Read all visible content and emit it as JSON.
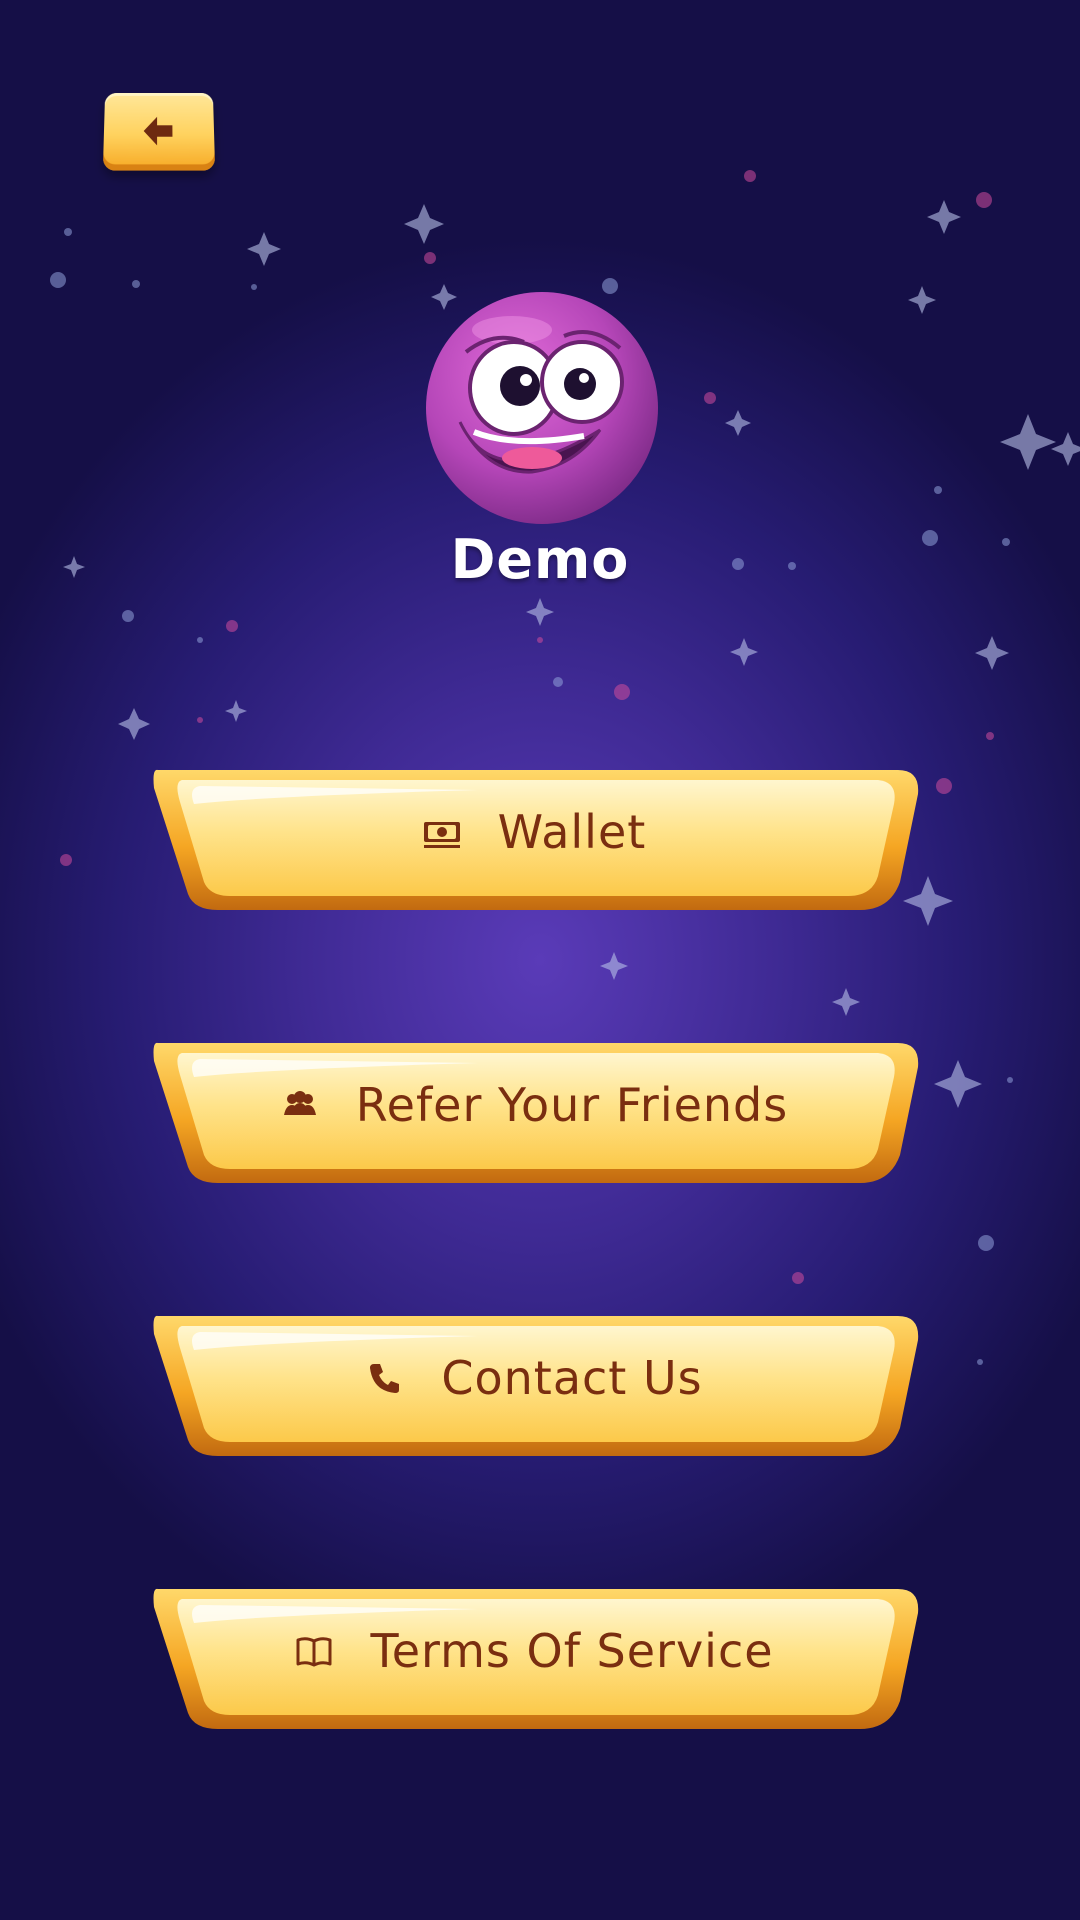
{
  "profile": {
    "username": "Demo",
    "avatar_icon": "purple-monster-avatar-icon"
  },
  "header": {
    "back_icon": "back-arrow-icon"
  },
  "menu": {
    "items": [
      {
        "label": "Wallet",
        "icon": "money-bill-icon"
      },
      {
        "label": "Refer Your Friends",
        "icon": "users-icon"
      },
      {
        "label": "Contact Us",
        "icon": "phone-icon"
      },
      {
        "label": "Terms Of Service",
        "icon": "book-icon"
      }
    ]
  },
  "colors": {
    "background": "#3f2a94",
    "button_gold": "#ffd25e",
    "button_text": "#7a2e10",
    "avatar": "#c84fc8"
  }
}
